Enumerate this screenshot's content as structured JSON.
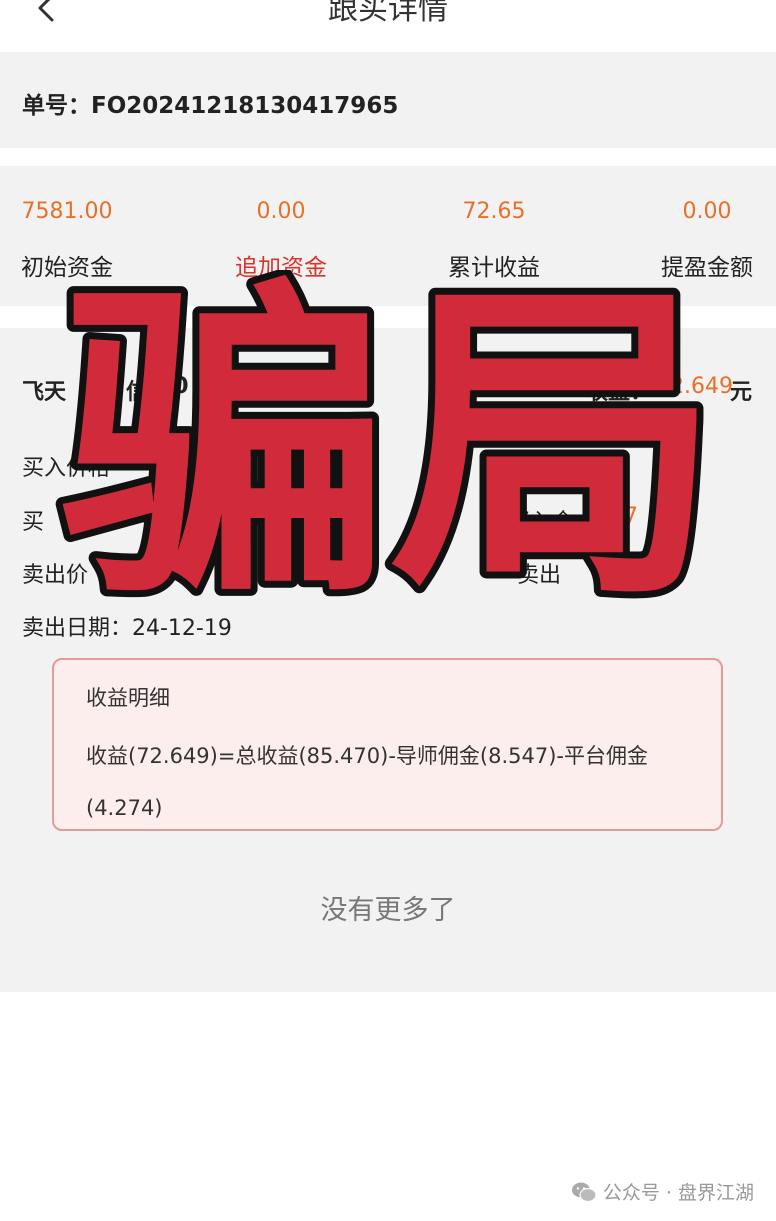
{
  "nav": {
    "title": "跟买详情",
    "back_icon": "chevron-left-icon"
  },
  "order": {
    "label": "单号：FO20241218130417965"
  },
  "stats": [
    {
      "value": "7581.00",
      "label": "初始资金"
    },
    {
      "value": "0.00",
      "label": "追加资金"
    },
    {
      "value": "72.65",
      "label": "累计收益"
    },
    {
      "value": "0.00",
      "label": "提盈金额"
    }
  ],
  "detail": {
    "title_fragment_1": "飞天",
    "title_fragment_2": "信",
    "title_fragment_3": "00",
    "income_label": "收益：",
    "income_value": "72.649",
    "income_unit": "元",
    "buy_price_fragment": "买入价格",
    "quantity_fragment": "数量：",
    "buy_fragment": "买",
    "buy_amount_fragment": "买入金",
    "buy_amount_value_fragment": "7",
    "sell_price_fragment": "卖出价",
    "sell_price_value_fragment": "0",
    "sell_amount_fragment": "卖出",
    "sell_amount_value_fragment": "0",
    "sell_date": "卖出日期：24-12-19"
  },
  "breakdown": {
    "heading": "收益明细",
    "formula": "收益(72.649)=总收益(85.470)-导师佣金(8.547)-平台佣金(4.274)"
  },
  "footer": {
    "no_more": "没有更多了"
  },
  "overlay": {
    "text": "骗局",
    "fill": "#d12b3b",
    "stroke": "#111111"
  },
  "watermark": {
    "text": "公众号 · 盘界江湖",
    "icon": "wechat-icon"
  },
  "colors": {
    "accent": "#e8702a",
    "red": "#d9342b",
    "bg": "#f2f2f2"
  }
}
